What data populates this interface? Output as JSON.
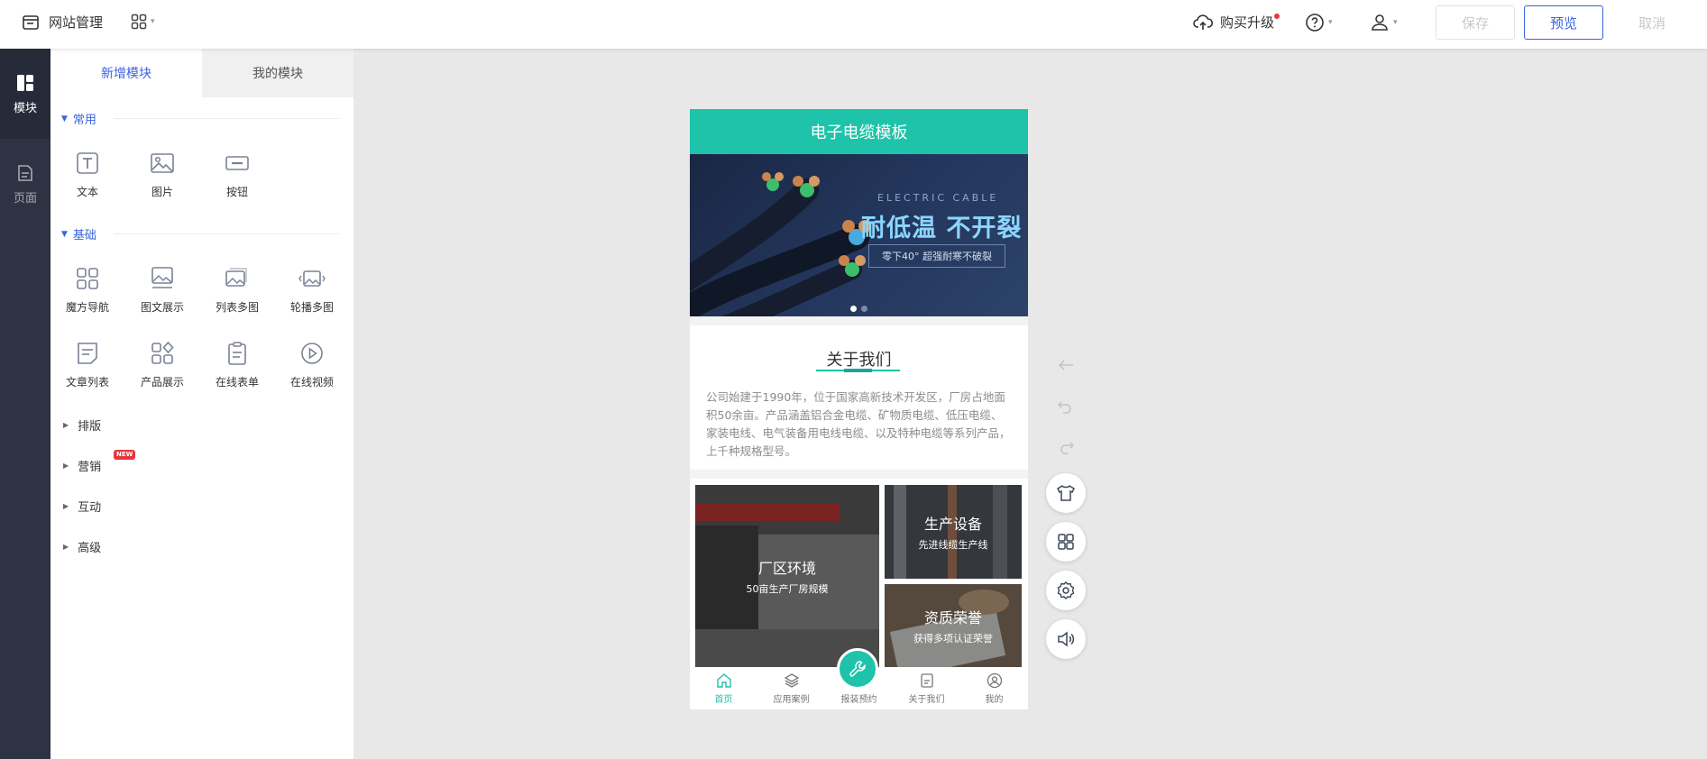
{
  "topbar": {
    "title": "网站管理",
    "upgrade_label": "购买升级",
    "save_label": "保存",
    "preview_label": "预览",
    "cancel_label": "取消"
  },
  "leftbar": {
    "items": [
      {
        "label": "模块",
        "icon": "module-icon"
      },
      {
        "label": "页面",
        "icon": "page-icon"
      }
    ]
  },
  "panel": {
    "tabs": [
      "新增模块",
      "我的模块"
    ],
    "sections": {
      "common": {
        "title": "常用",
        "items": [
          "文本",
          "图片",
          "按钮"
        ]
      },
      "basic": {
        "title": "基础",
        "items": [
          "魔方导航",
          "图文展示",
          "列表多图",
          "轮播多图",
          "文章列表",
          "产品展示",
          "在线表单",
          "在线视频"
        ]
      },
      "collapsed": [
        "排版",
        "营销",
        "互动",
        "高级"
      ],
      "new_badge": "NEW"
    }
  },
  "phone": {
    "header_title": "电子电缆模板",
    "banner": {
      "en": "ELECTRIC CABLE",
      "headline": "耐低温 不开裂",
      "sub": "零下40° 超强耐寒不破裂"
    },
    "about": {
      "title": "关于我们",
      "text": "公司始建于1990年，位于国家高新技术开发区，厂房占地面积50余亩。产品涵盖铝合金电缆、矿物质电缆、低压电缆、家装电线、电气装备用电线电缆、以及特种电缆等系列产品，上千种规格型号。"
    },
    "gallery": [
      {
        "title": "厂区环境",
        "sub": "50亩生产厂房规模"
      },
      {
        "title": "生产设备",
        "sub": "先进线缆生产线"
      },
      {
        "title": "资质荣誉",
        "sub": "获得多项认证荣誉"
      }
    ],
    "tabbar": [
      "首页",
      "应用案例",
      "报装预约",
      "关于我们",
      "我的"
    ]
  },
  "colors": {
    "accent": "#1ec3aa",
    "primary": "#3a64e0",
    "sidebar": "#2d3343"
  }
}
